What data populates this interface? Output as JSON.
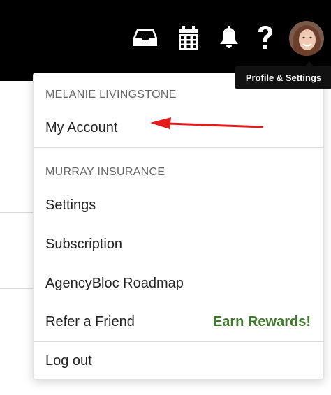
{
  "topbar": {
    "icons": [
      "inbox-icon",
      "calendar-icon",
      "bell-icon",
      "help-icon"
    ],
    "avatar": "user-avatar",
    "tooltip": "Profile & Settings"
  },
  "menu": {
    "user_section": {
      "header": "MELANIE LIVINGSTONE",
      "items": [
        "My Account"
      ]
    },
    "company_section": {
      "header": "MURRAY INSURANCE",
      "items": [
        "Settings",
        "Subscription",
        "AgencyBloc Roadmap",
        "Refer a Friend"
      ],
      "refer_badge": "Earn Rewards!"
    },
    "logout": "Log out"
  },
  "colors": {
    "topbar_bg": "#000000",
    "accent_green": "#3f7a2c",
    "annotation_arrow": "#e21b1b",
    "header_text": "#666666"
  }
}
